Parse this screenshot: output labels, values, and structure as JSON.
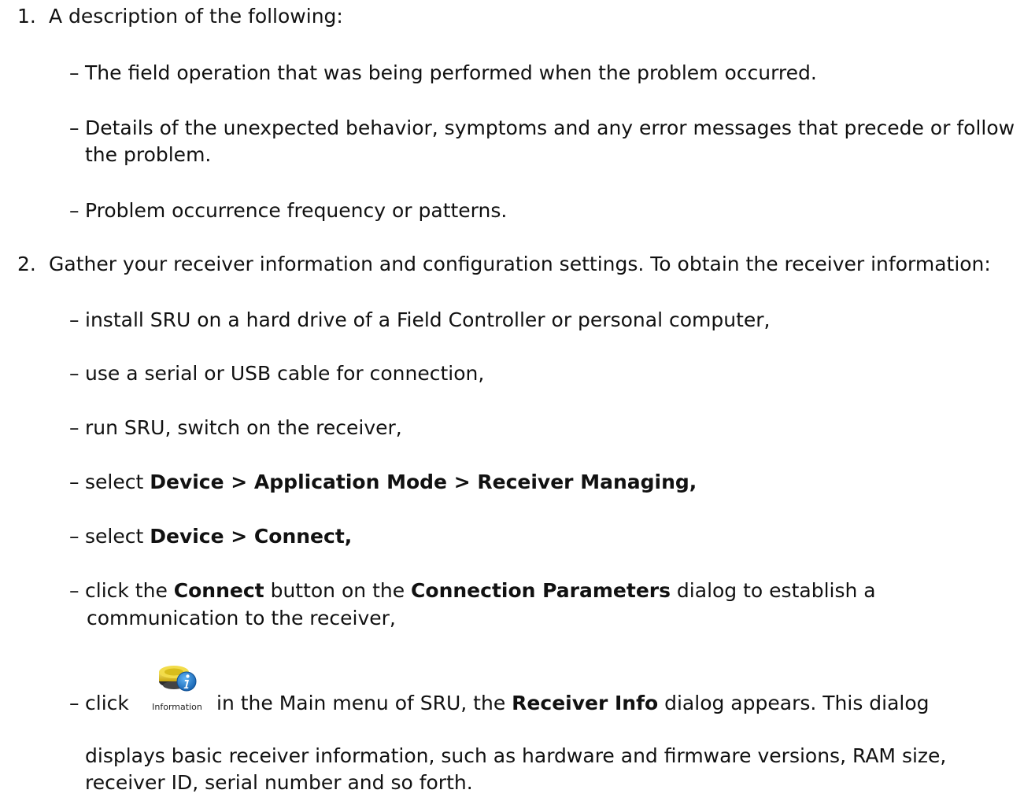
{
  "item1": {
    "number": "1.",
    "text": "A description of the following:",
    "bullets": [
      "The field operation that was being performed when the problem occurred.",
      "Details of the unexpected behavior, symptoms and any error messages that precede or follow",
      "the problem.",
      "Problem occurrence frequency or patterns."
    ]
  },
  "item2": {
    "number": "2.",
    "text": "Gather your receiver information and configuration settings. To obtain the receiver information:",
    "b1": "install SRU on a hard drive of a Field Controller or personal computer,",
    "b2": "use a serial or USB cable for connection,",
    "b3": "run SRU, switch on the receiver,",
    "b4_pre": "select ",
    "b4_bold": "Device > Application Mode > Receiver Managing,",
    "b5_pre": "select ",
    "b5_bold": "Device > Connect,",
    "b6_pre": "click the ",
    "b6_bold1": "Connect",
    "b6_mid": " button on the ",
    "b6_bold2": "Connection Parameters",
    "b6_post": " dialog to establish a",
    "b6_cont": "communication to the receiver,",
    "b7_pre": "click",
    "b7_mid": "in the Main menu of SRU, the ",
    "b7_bold": "Receiver Info",
    "b7_post": " dialog appears. This dialog",
    "b7_cont1": "displays basic receiver information, such as hardware and firmware versions, RAM size,",
    "b7_cont2": "receiver ID, serial number and so forth."
  },
  "dash": "–",
  "icon": {
    "name": "information-icon",
    "label": "Information",
    "colors": {
      "body": "#e0c020",
      "base": "#2c2c2c",
      "badge": "#1f7fd6"
    }
  }
}
